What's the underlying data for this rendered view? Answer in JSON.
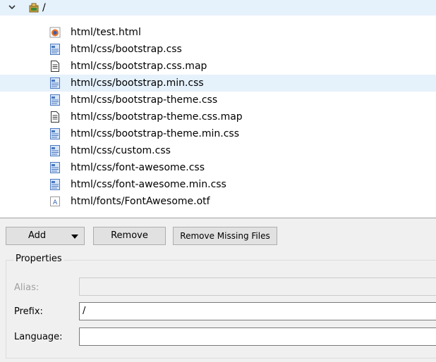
{
  "tree": {
    "root": {
      "label": "/",
      "icon": "resource-folder-icon",
      "expanded": true
    },
    "items": [
      {
        "label": "html/test.html",
        "icon": "firefox-html-file-icon",
        "selected": false
      },
      {
        "label": "html/css/bootstrap.css",
        "icon": "css-file-icon",
        "selected": false
      },
      {
        "label": "html/css/bootstrap.css.map",
        "icon": "text-file-icon",
        "selected": false
      },
      {
        "label": "html/css/bootstrap.min.css",
        "icon": "css-file-icon",
        "selected": true
      },
      {
        "label": "html/css/bootstrap-theme.css",
        "icon": "css-file-icon",
        "selected": false
      },
      {
        "label": "html/css/bootstrap-theme.css.map",
        "icon": "text-file-icon",
        "selected": false
      },
      {
        "label": "html/css/bootstrap-theme.min.css",
        "icon": "css-file-icon",
        "selected": false
      },
      {
        "label": "html/css/custom.css",
        "icon": "css-file-icon",
        "selected": false
      },
      {
        "label": "html/css/font-awesome.css",
        "icon": "css-file-icon",
        "selected": false
      },
      {
        "label": "html/css/font-awesome.min.css",
        "icon": "css-file-icon",
        "selected": false
      },
      {
        "label": "html/fonts/FontAwesome.otf",
        "icon": "font-file-icon",
        "selected": false
      }
    ]
  },
  "toolbar": {
    "add_label": "Add",
    "remove_label": "Remove",
    "remove_missing_label": "Remove Missing Files"
  },
  "properties": {
    "title": "Properties",
    "alias_label": "Alias:",
    "alias_value": "",
    "prefix_label": "Prefix:",
    "prefix_value": "/",
    "language_label": "Language:",
    "language_value": ""
  },
  "colors": {
    "selection": "#e5f1fb",
    "panel_bg": "#f0f0f0",
    "button_bg": "#e1e1e1"
  }
}
